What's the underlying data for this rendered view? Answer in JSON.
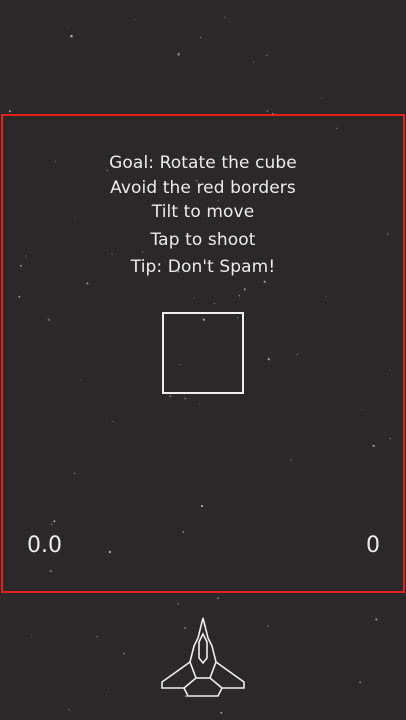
{
  "game": {
    "instructions": [
      "Goal: Rotate the cube",
      "Avoid the red borders",
      "Tilt to move",
      "Tap to shoot",
      "Tip: Don't Spam!"
    ],
    "timer": "0.0",
    "score": "0"
  },
  "colors": {
    "background": "#2b2829",
    "border": "#e2231a",
    "foreground": "#efefef"
  },
  "icons": {
    "player": "spaceship-icon",
    "target": "cube-icon"
  }
}
